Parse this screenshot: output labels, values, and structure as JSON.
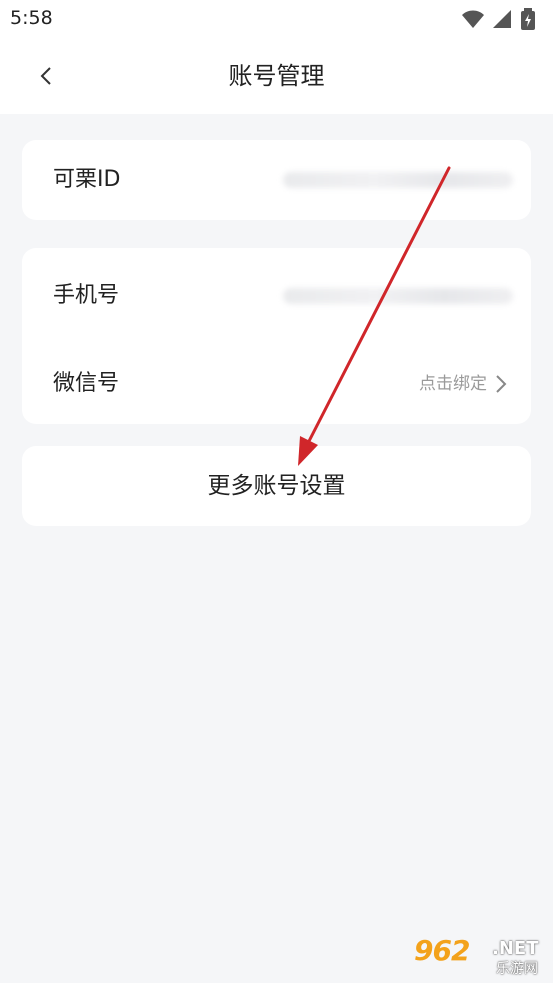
{
  "status_bar": {
    "time": "5:58",
    "icons": [
      "wifi-icon",
      "signal-icon",
      "battery-charging-icon"
    ]
  },
  "header": {
    "title": "账号管理",
    "back_icon": "chevron-left-icon"
  },
  "sections": {
    "keli_id": {
      "label": "可栗ID"
    },
    "phone": {
      "label": "手机号"
    },
    "wechat": {
      "label": "微信号",
      "hint": "点击绑定"
    }
  },
  "more_settings": {
    "label": "更多账号设置"
  },
  "annotation": {
    "color": "#d0262a"
  },
  "watermark": {
    "number": "962",
    "domain": ".NET",
    "site": "乐游网"
  }
}
